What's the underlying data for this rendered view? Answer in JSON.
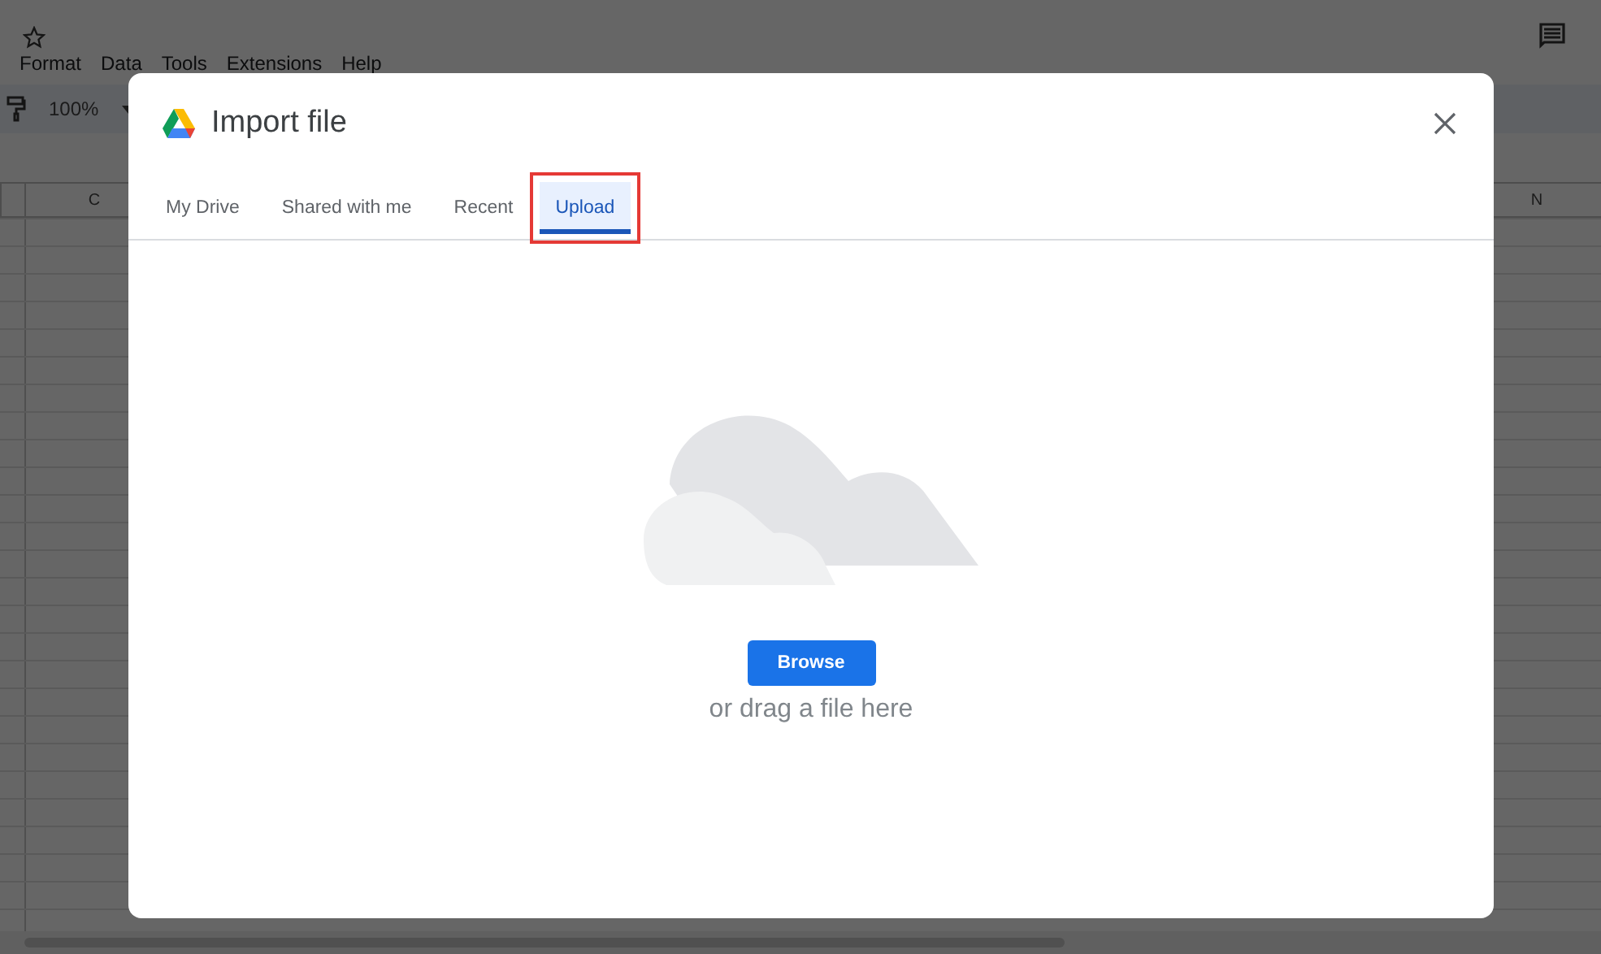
{
  "spreadsheet": {
    "menu": [
      "Format",
      "Data",
      "Tools",
      "Extensions",
      "Help"
    ],
    "zoom": "100%",
    "columns": [
      {
        "label": "C"
      },
      {
        "label": "N"
      }
    ]
  },
  "dialog": {
    "title": "Import file",
    "tabs": [
      {
        "label": "My Drive",
        "selected": false
      },
      {
        "label": "Shared with me",
        "selected": false
      },
      {
        "label": "Recent",
        "selected": false
      },
      {
        "label": "Upload",
        "selected": true,
        "highlighted": true
      }
    ],
    "browse_button": "Browse",
    "drop_hint": "or drag a file here"
  }
}
